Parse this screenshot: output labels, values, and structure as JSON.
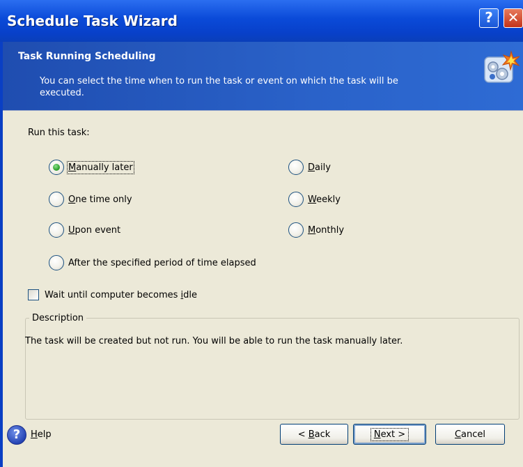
{
  "window": {
    "title": "Schedule Task Wizard",
    "help_glyph": "?",
    "close_glyph": "✕"
  },
  "header": {
    "title": "Task Running Scheduling",
    "description": "You can select the time when to run the task or event on which the task will be executed.",
    "icon": "schedule-gear-icon"
  },
  "run_label": "Run this task:",
  "options": {
    "manually_later": {
      "pre": "",
      "key": "M",
      "post": "anually later",
      "selected": true
    },
    "one_time_only": {
      "pre": "",
      "key": "O",
      "post": "ne time only",
      "selected": false
    },
    "upon_event": {
      "pre": "",
      "key": "U",
      "post": "pon event",
      "selected": false
    },
    "after_period": {
      "pre": "After the specified period of time elapsed",
      "key": "",
      "post": "",
      "selected": false
    },
    "daily": {
      "pre": "",
      "key": "D",
      "post": "aily",
      "selected": false
    },
    "weekly": {
      "pre": "",
      "key": "W",
      "post": "eekly",
      "selected": false
    },
    "monthly": {
      "pre": "",
      "key": "M",
      "post": "onthly",
      "selected": false
    }
  },
  "idle_checkbox": {
    "pre": "Wait until computer becomes ",
    "key": "i",
    "post": "dle",
    "checked": false
  },
  "description": {
    "title": "Description",
    "text": "The task will be created but not run. You will be able to run the task manually later."
  },
  "footer": {
    "help": {
      "pre": "",
      "key": "H",
      "post": "elp"
    },
    "back": {
      "pre": "< ",
      "key": "B",
      "post": "ack"
    },
    "next": {
      "pre": "",
      "key": "N",
      "post": "ext >"
    },
    "cancel": {
      "pre": "",
      "key": "C",
      "post": "ancel"
    }
  },
  "colors": {
    "titlebar": "#0a4ad8",
    "header": "#2a62c9",
    "client": "#ece9d8",
    "radio_selected": "#2fa52f",
    "close_button": "#c4331a"
  }
}
